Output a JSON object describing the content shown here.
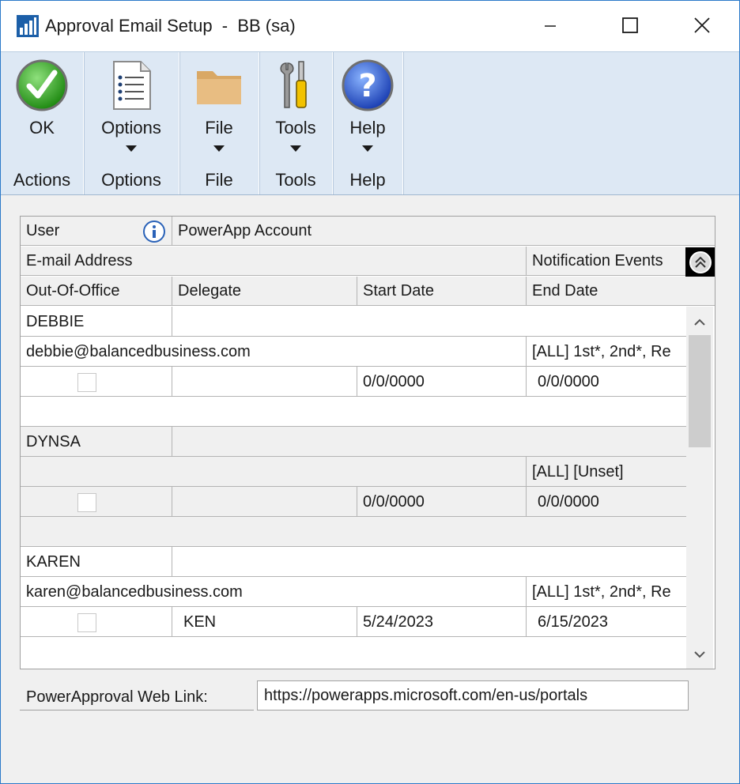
{
  "window": {
    "title": "Approval Email Setup  -  BB (sa)",
    "controls": [
      "minimize-icon",
      "maximize-icon",
      "close-icon"
    ]
  },
  "ribbon": {
    "groups": [
      {
        "button_label": "OK",
        "group_label": "Actions",
        "icon": "checkmark-icon",
        "has_dropdown": false
      },
      {
        "button_label": "Options",
        "group_label": "Options",
        "icon": "options-list-icon",
        "has_dropdown": true
      },
      {
        "button_label": "File",
        "group_label": "File",
        "icon": "folder-icon",
        "has_dropdown": true
      },
      {
        "button_label": "Tools",
        "group_label": "Tools",
        "icon": "tools-icon",
        "has_dropdown": true
      },
      {
        "button_label": "Help",
        "group_label": "Help",
        "icon": "help-icon",
        "has_dropdown": true
      }
    ]
  },
  "grid": {
    "headers": {
      "user": "User",
      "powerapp_account": "PowerApp Account",
      "email_address": "E-mail Address",
      "notification_events": "Notification Events",
      "out_of_office": "Out-Of-Office",
      "delegate": "Delegate",
      "start_date": "Start Date",
      "end_date": "End Date"
    },
    "records": [
      {
        "user": "DEBBIE",
        "powerapp_account": "",
        "email": "debbie@balancedbusiness.com",
        "notification_events": "[ALL] 1st*, 2nd*, Re",
        "out_of_office": false,
        "delegate": "",
        "start_date": "0/0/0000",
        "end_date": "0/0/0000"
      },
      {
        "user": "DYNSA",
        "powerapp_account": "",
        "email": "",
        "notification_events": "[ALL] [Unset]",
        "out_of_office": false,
        "delegate": "",
        "start_date": "0/0/0000",
        "end_date": "0/0/0000"
      },
      {
        "user": "KAREN",
        "powerapp_account": "",
        "email": "karen@balancedbusiness.com",
        "notification_events": "[ALL] 1st*, 2nd*, Re",
        "out_of_office": false,
        "delegate": "KEN",
        "start_date": "5/24/2023",
        "end_date": "6/15/2023"
      }
    ]
  },
  "weblink": {
    "label": "PowerApproval Web Link:",
    "value": "https://powerapps.microsoft.com/en-us/portals"
  }
}
